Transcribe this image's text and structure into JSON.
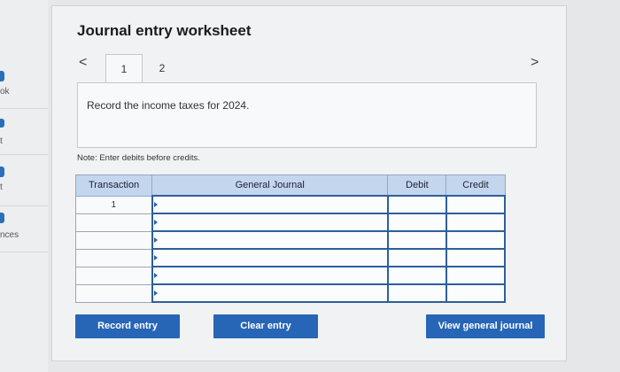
{
  "sidebar": {
    "items": [
      {
        "label": "ok"
      },
      {
        "label": "t"
      },
      {
        "label": "t"
      },
      {
        "label": "nces"
      }
    ]
  },
  "worksheet": {
    "title": "Journal entry worksheet",
    "nav_prev": "<",
    "nav_next": ">",
    "tabs": [
      {
        "label": "1",
        "active": true
      },
      {
        "label": "2",
        "active": false
      }
    ],
    "instruction": "Record the income taxes for 2024.",
    "note": "Note: Enter debits before credits."
  },
  "journal_table": {
    "headers": [
      "Transaction",
      "General Journal",
      "Debit",
      "Credit"
    ],
    "rows": [
      {
        "transaction": "1",
        "account": "",
        "debit": "",
        "credit": ""
      },
      {
        "transaction": "",
        "account": "",
        "debit": "",
        "credit": ""
      },
      {
        "transaction": "",
        "account": "",
        "debit": "",
        "credit": ""
      },
      {
        "transaction": "",
        "account": "",
        "debit": "",
        "credit": ""
      },
      {
        "transaction": "",
        "account": "",
        "debit": "",
        "credit": ""
      },
      {
        "transaction": "",
        "account": "",
        "debit": "",
        "credit": ""
      }
    ]
  },
  "buttons": {
    "record": "Record entry",
    "clear": "Clear entry",
    "view": "View general journal"
  },
  "colors": {
    "accent": "#2765b7",
    "header_bg": "#c3d6ee"
  }
}
